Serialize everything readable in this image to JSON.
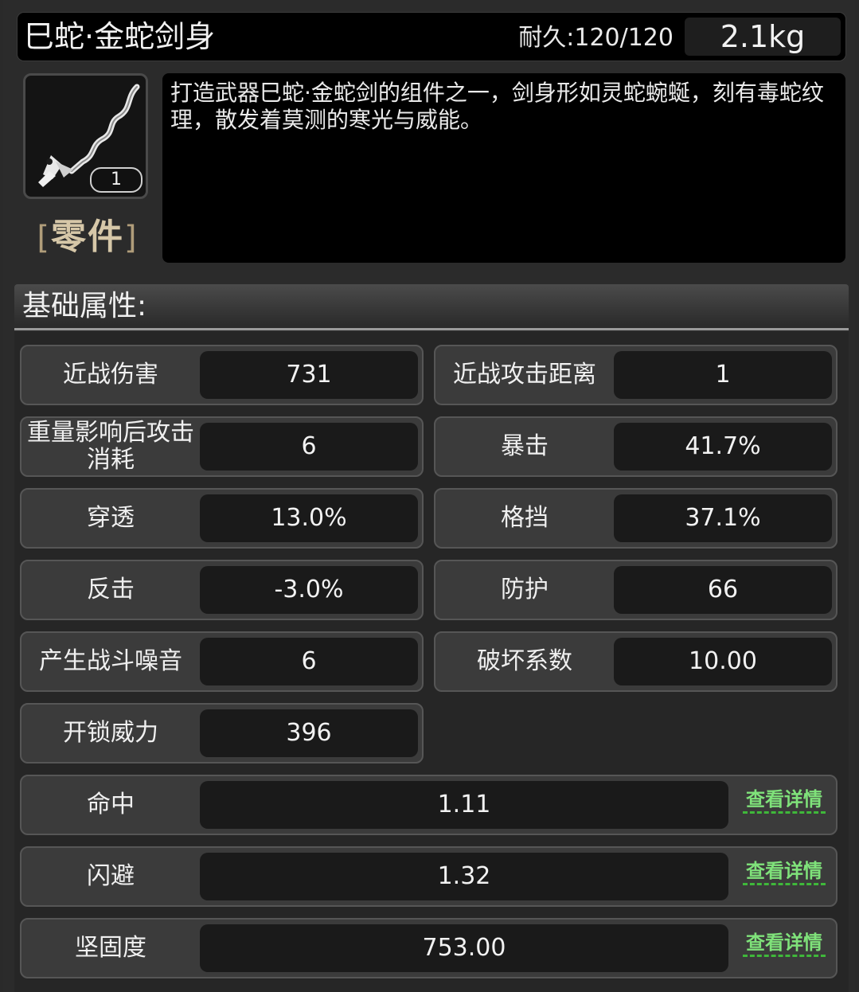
{
  "item": {
    "name": "巳蛇·金蛇剑身",
    "durability": "耐久:120/120",
    "weight": "2.1kg",
    "count": "1",
    "category": "零件",
    "description": "打造武器巳蛇·金蛇剑的组件之一，剑身形如灵蛇蜿蜒，刻有毒蛇纹理，散发着莫测的寒光与威能。",
    "icon": "snake-sword-blade-icon"
  },
  "section_title": "基础属性:",
  "stats": [
    {
      "label": "近战伤害",
      "value": "731"
    },
    {
      "label": "近战攻击距离",
      "value": "1"
    },
    {
      "label": "重量影响后攻击消耗",
      "value": "6"
    },
    {
      "label": "暴击",
      "value": "41.7%"
    },
    {
      "label": "穿透",
      "value": "13.0%"
    },
    {
      "label": "格挡",
      "value": "37.1%"
    },
    {
      "label": "反击",
      "value": "-3.0%"
    },
    {
      "label": "防护",
      "value": "66"
    },
    {
      "label": "产生战斗噪音",
      "value": "6"
    },
    {
      "label": "破坏系数",
      "value": "10.00"
    },
    {
      "label": "开锁威力",
      "value": "396"
    }
  ],
  "detail_stats": [
    {
      "label": "命中",
      "value": "1.11",
      "link": "查看详情"
    },
    {
      "label": "闪避",
      "value": "1.32",
      "link": "查看详情"
    },
    {
      "label": "坚固度",
      "value": "753.00",
      "link": "查看详情"
    }
  ]
}
